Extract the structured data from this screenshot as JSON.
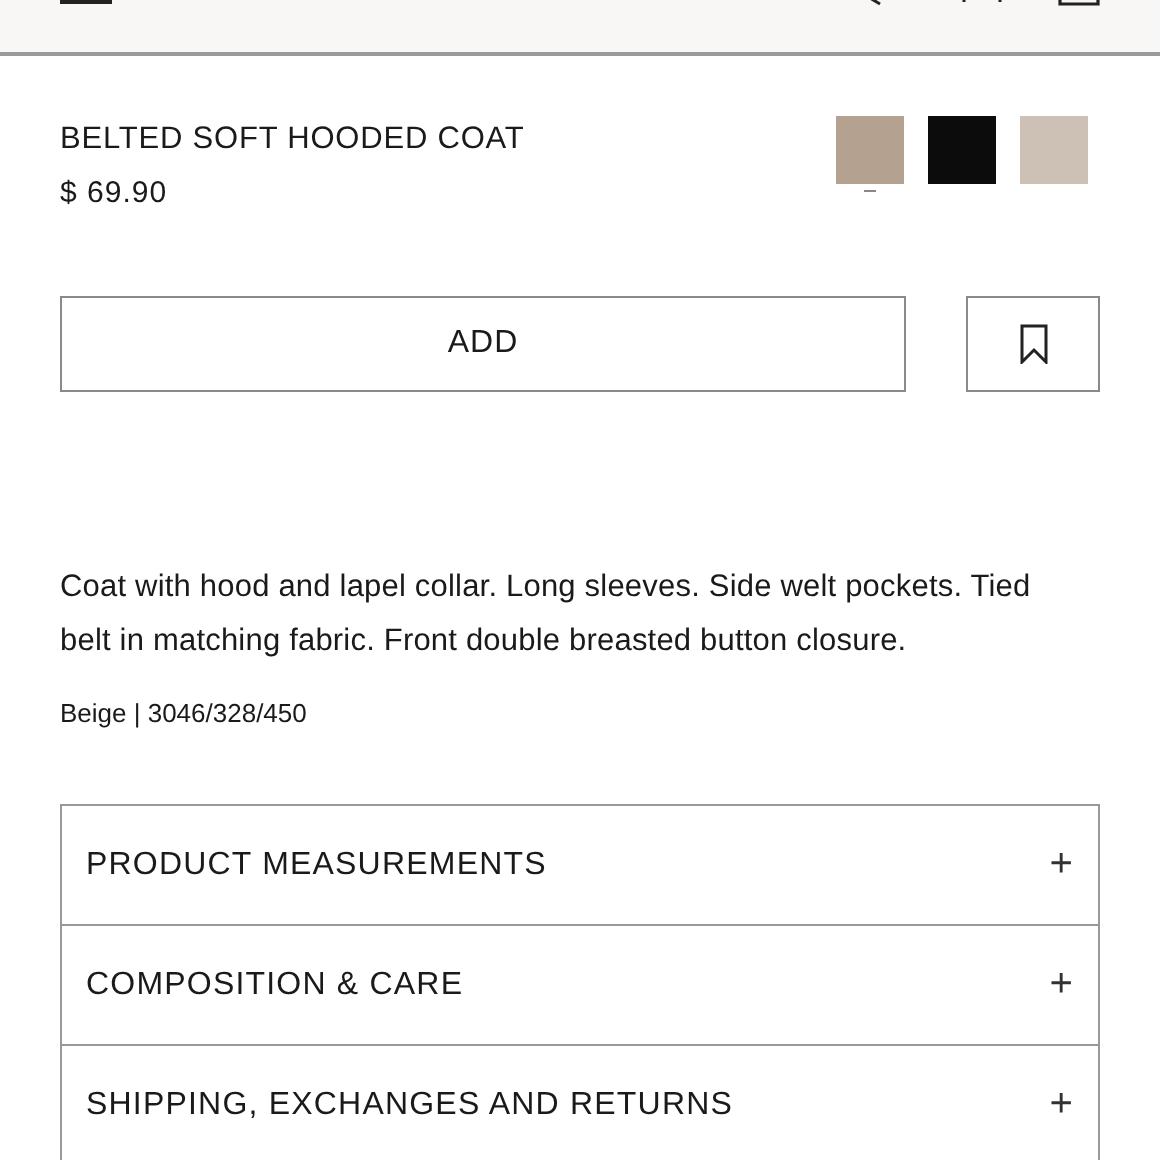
{
  "product": {
    "title": "BELTED SOFT HOODED COAT",
    "price": "$ 69.90"
  },
  "swatches": [
    {
      "color": "#b5a190",
      "selected": true
    },
    {
      "color": "#0c0c0c",
      "selected": false
    },
    {
      "color": "#cdc1b5",
      "selected": false
    }
  ],
  "add_button": "ADD",
  "description": "Coat with hood and lapel collar. Long sleeves. Side welt pockets. Tied belt in matching fabric. Front double breasted button closure.",
  "reference": "Beige | 3046/328/450",
  "sections": [
    {
      "label": "PRODUCT MEASUREMENTS",
      "expand": "+"
    },
    {
      "label": "COMPOSITION & CARE",
      "expand": "+"
    },
    {
      "label": "SHIPPING, EXCHANGES AND RETURNS",
      "expand": "+"
    }
  ]
}
